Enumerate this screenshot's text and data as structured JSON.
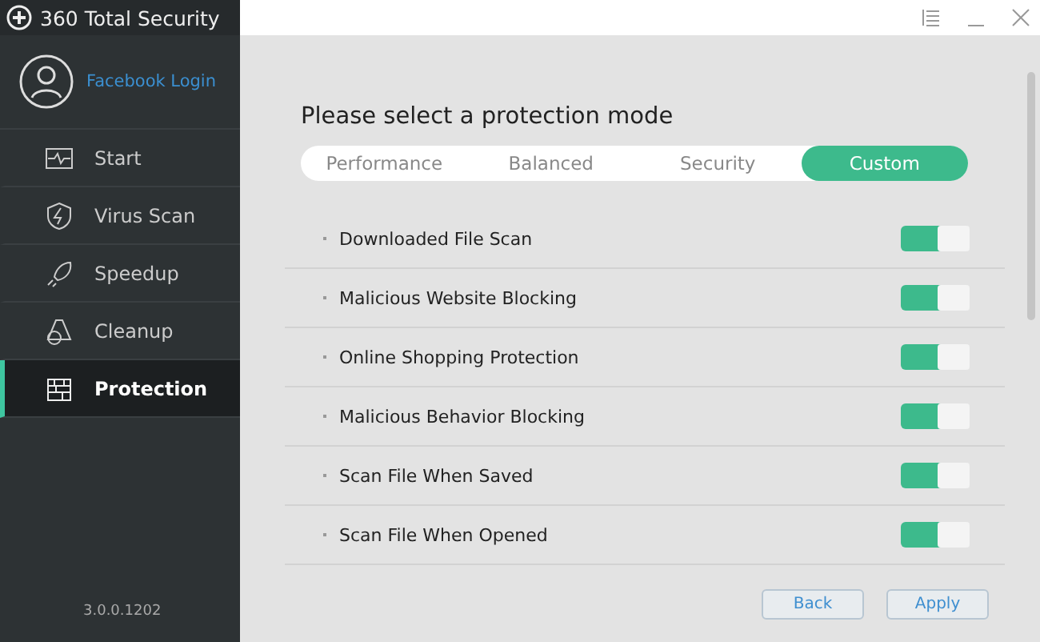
{
  "app": {
    "title": "360 Total Security",
    "version": "3.0.0.1202"
  },
  "profile": {
    "login": "Facebook Login"
  },
  "sidebar": {
    "items": [
      {
        "label": "Start",
        "kind": "pulse",
        "selected": false
      },
      {
        "label": "Virus Scan",
        "kind": "shield",
        "selected": false
      },
      {
        "label": "Speedup",
        "kind": "rocket",
        "selected": false
      },
      {
        "label": "Cleanup",
        "kind": "broom",
        "selected": false
      },
      {
        "label": "Protection",
        "kind": "wall",
        "selected": true
      }
    ]
  },
  "heading": "Please select a protection mode",
  "modes": [
    {
      "label": "Performance",
      "selected": false
    },
    {
      "label": "Balanced",
      "selected": false
    },
    {
      "label": "Security",
      "selected": false
    },
    {
      "label": "Custom",
      "selected": true
    }
  ],
  "settings": [
    {
      "label": "Downloaded File Scan",
      "on": true
    },
    {
      "label": "Malicious Website Blocking",
      "on": true
    },
    {
      "label": "Online Shopping Protection",
      "on": true
    },
    {
      "label": "Malicious Behavior Blocking",
      "on": true
    },
    {
      "label": "Scan File When Saved",
      "on": true
    },
    {
      "label": "Scan File When Opened",
      "on": true
    }
  ],
  "buttons": [
    "Back",
    "Apply"
  ]
}
